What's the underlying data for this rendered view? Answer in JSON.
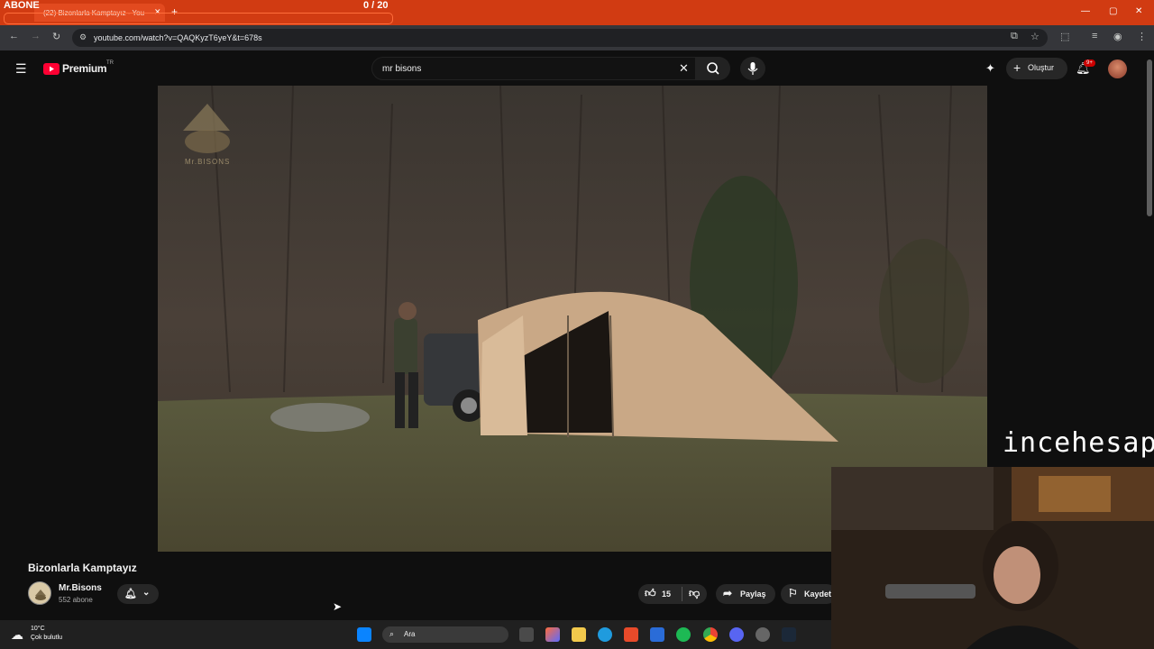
{
  "overlay": {
    "label": "ABONE",
    "counter": "0 / 20"
  },
  "browser": {
    "tab_title": "(22) Bizonlarla Kamptayız - You",
    "url": "youtube.com/watch?v=QAQKyzT6yeY&t=678s"
  },
  "youtube": {
    "logo_text": "Premium",
    "region": "TR",
    "search_value": "mr bisons",
    "create_label": "Oluştur",
    "notif_badge": "9+"
  },
  "video": {
    "title": "Bizonlarla Kamptayız",
    "channel": "Mr.Bisons",
    "subscribers": "552 abone",
    "likes": "15",
    "share_label": "Paylaş",
    "save_label": "Kaydet",
    "logo_caption": "Mr.BISONS"
  },
  "stream": {
    "watermark": "incehesap"
  },
  "taskbar": {
    "temp": "10°C",
    "weather": "Çok bulutlu",
    "search_placeholder": "Ara"
  },
  "colors": {
    "titlebar": "#d13b12",
    "yt_red": "#ff0033"
  }
}
